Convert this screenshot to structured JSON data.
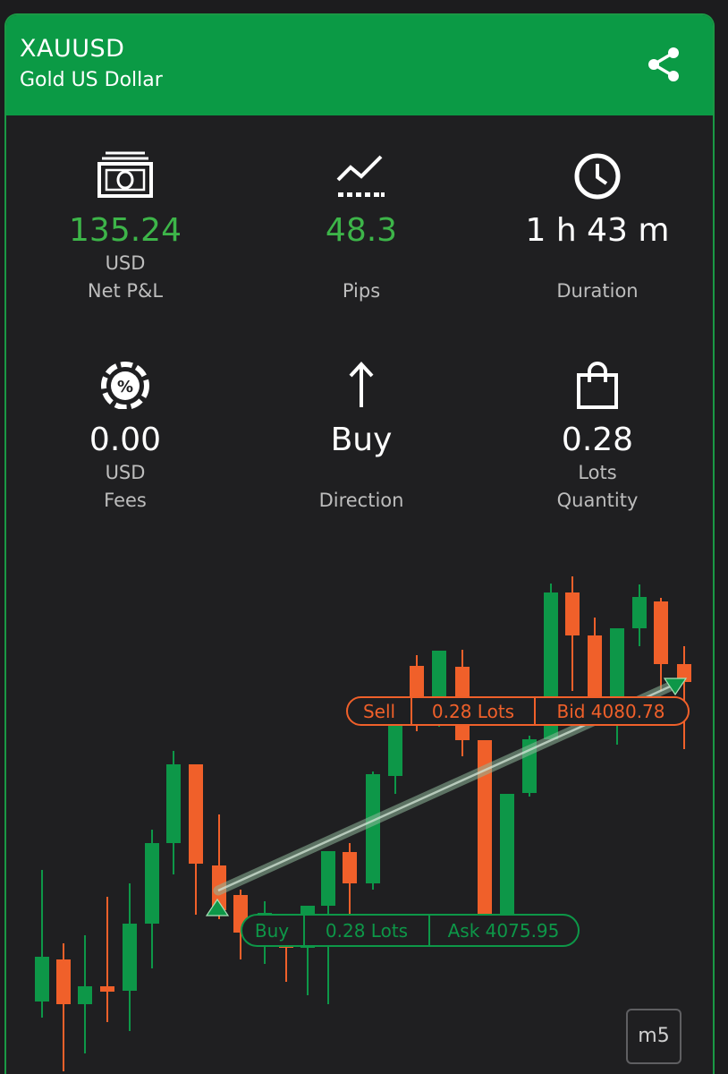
{
  "header": {
    "symbol": "XAUUSD",
    "name": "Gold US Dollar",
    "share_icon": "share-icon",
    "color": "#0b9a45"
  },
  "stats": {
    "net_pnl": {
      "icon": "banknote-icon",
      "value": "135.24",
      "unit": "USD",
      "label": "Net P&L",
      "color": "#3db549"
    },
    "pips": {
      "icon": "trend-chart-icon",
      "value": "48.3",
      "label": "Pips",
      "color": "#3db549"
    },
    "duration": {
      "icon": "clock-icon",
      "value": "1 h 43 m",
      "label": "Duration"
    },
    "fees": {
      "icon": "percent-circle-icon",
      "value": "0.00",
      "unit": "USD",
      "label": "Fees"
    },
    "direction": {
      "icon": "arrow-up-icon",
      "value": "Buy",
      "label": "Direction"
    },
    "quantity": {
      "icon": "shopping-bag-icon",
      "value": "0.28",
      "unit": "Lots",
      "label": "Quantity"
    }
  },
  "chart": {
    "timeframe": "m5",
    "up_color": "#0d9748",
    "down_color": "#f0602a",
    "buy_tag": {
      "side": "Buy",
      "lots": "0.28 Lots",
      "price": "Ask 4075.95"
    },
    "sell_tag": {
      "side": "Sell",
      "lots": "0.28 Lots",
      "price": "Bid 4080.78"
    }
  }
}
